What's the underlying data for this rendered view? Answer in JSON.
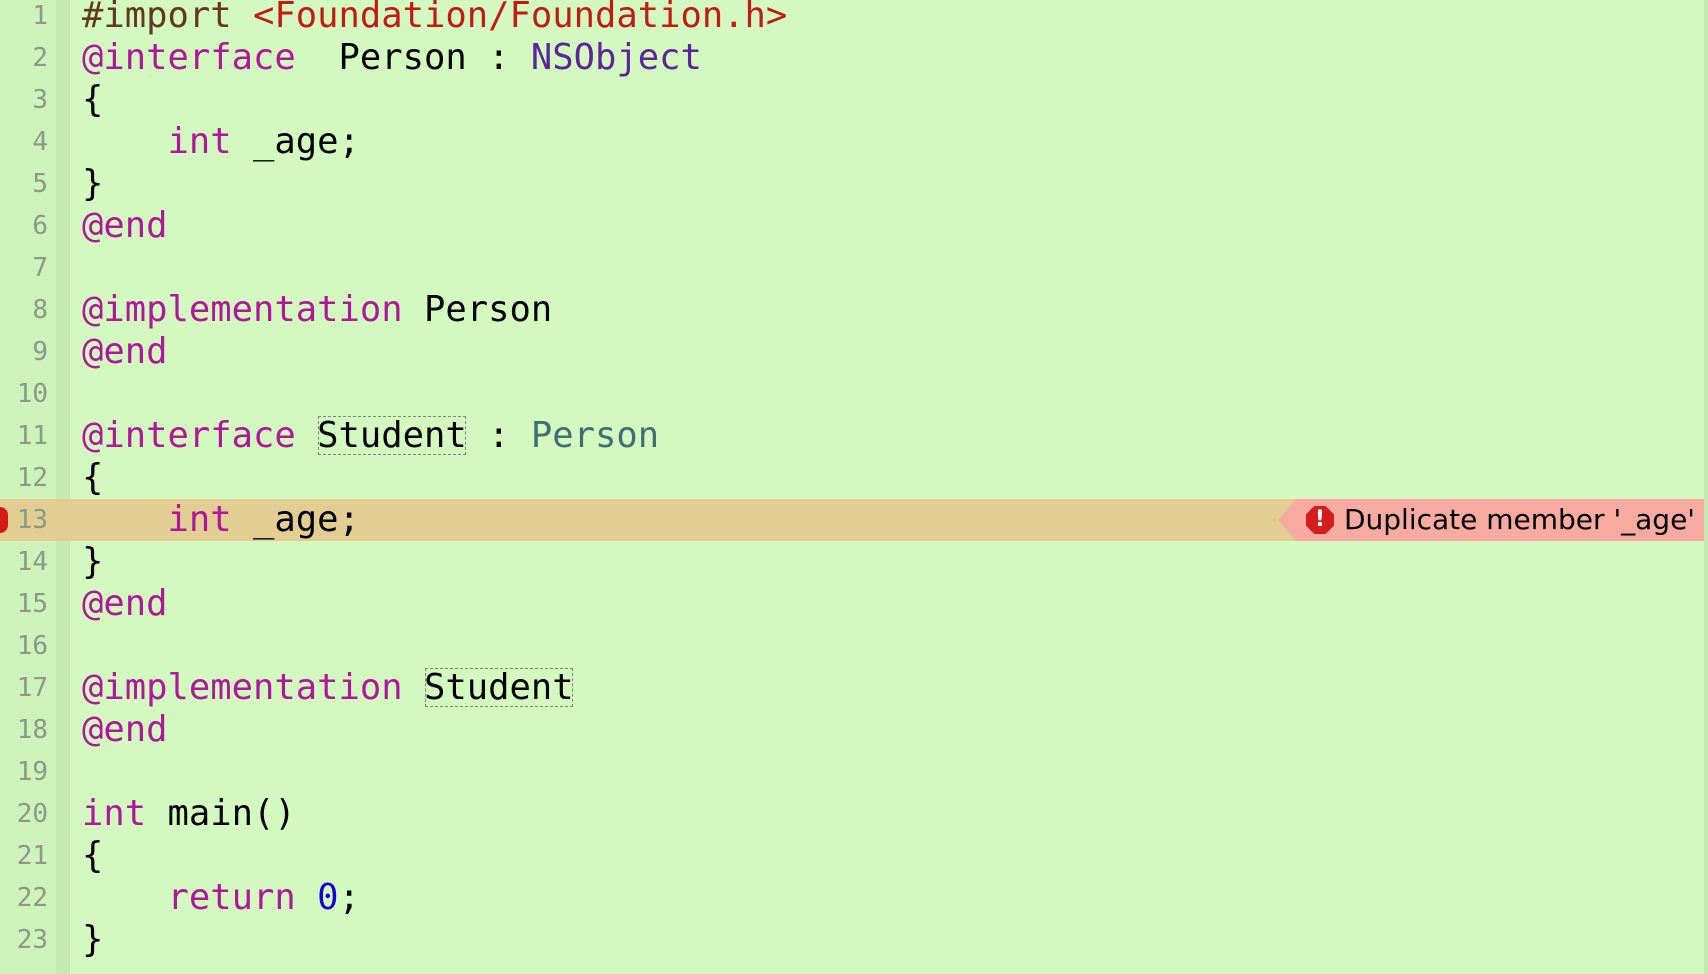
{
  "editor": {
    "lines": [
      {
        "n": "1",
        "tokens": [
          [
            "pp",
            "#import "
          ],
          [
            "str",
            "<Foundation/Foundation.h>"
          ]
        ]
      },
      {
        "n": "2",
        "tokens": [
          [
            "kw",
            "@interface"
          ],
          [
            "",
            "  Person : "
          ],
          [
            "cls",
            "NSObject"
          ]
        ]
      },
      {
        "n": "3",
        "tokens": [
          [
            "",
            "{"
          ]
        ]
      },
      {
        "n": "4",
        "tokens": [
          [
            "",
            "    "
          ],
          [
            "kw",
            "int"
          ],
          [
            "",
            " _age;"
          ]
        ]
      },
      {
        "n": "5",
        "tokens": [
          [
            "",
            "}"
          ]
        ]
      },
      {
        "n": "6",
        "tokens": [
          [
            "kw",
            "@end"
          ]
        ]
      },
      {
        "n": "7",
        "tokens": []
      },
      {
        "n": "8",
        "tokens": [
          [
            "kw",
            "@implementation"
          ],
          [
            "",
            " Person"
          ]
        ]
      },
      {
        "n": "9",
        "tokens": [
          [
            "kw",
            "@end"
          ]
        ]
      },
      {
        "n": "10",
        "tokens": []
      },
      {
        "n": "11",
        "tokens": [
          [
            "kw",
            "@interface"
          ],
          [
            "",
            " "
          ],
          [
            "box",
            "Student"
          ],
          [
            "",
            " : "
          ],
          [
            "tp",
            "Person"
          ]
        ]
      },
      {
        "n": "12",
        "tokens": [
          [
            "",
            "{"
          ]
        ]
      },
      {
        "n": "13",
        "tokens": [
          [
            "",
            "    "
          ],
          [
            "kw",
            "int"
          ],
          [
            "",
            " _age;"
          ]
        ],
        "error": "Duplicate member '_age'"
      },
      {
        "n": "14",
        "tokens": [
          [
            "",
            "}"
          ]
        ]
      },
      {
        "n": "15",
        "tokens": [
          [
            "kw",
            "@end"
          ]
        ]
      },
      {
        "n": "16",
        "tokens": []
      },
      {
        "n": "17",
        "tokens": [
          [
            "kw",
            "@implementation"
          ],
          [
            "",
            " "
          ],
          [
            "box",
            "Student"
          ]
        ]
      },
      {
        "n": "18",
        "tokens": [
          [
            "kw",
            "@end"
          ]
        ]
      },
      {
        "n": "19",
        "tokens": []
      },
      {
        "n": "20",
        "tokens": [
          [
            "kw",
            "int"
          ],
          [
            "",
            " main()"
          ]
        ]
      },
      {
        "n": "21",
        "tokens": [
          [
            "",
            "{"
          ]
        ]
      },
      {
        "n": "22",
        "tokens": [
          [
            "",
            "    "
          ],
          [
            "kw",
            "return"
          ],
          [
            "",
            " "
          ],
          [
            "num",
            "0"
          ],
          [
            "",
            ";"
          ]
        ]
      },
      {
        "n": "23",
        "tokens": [
          [
            "",
            "}"
          ]
        ]
      }
    ],
    "error_icon": "error-octagon-icon",
    "colors": {
      "background": "#d3f9c0",
      "keyword": "#b0189c",
      "string": "#c41a16",
      "error_line": "#e2cd92",
      "error_bubble": "#f6aaa0"
    }
  }
}
